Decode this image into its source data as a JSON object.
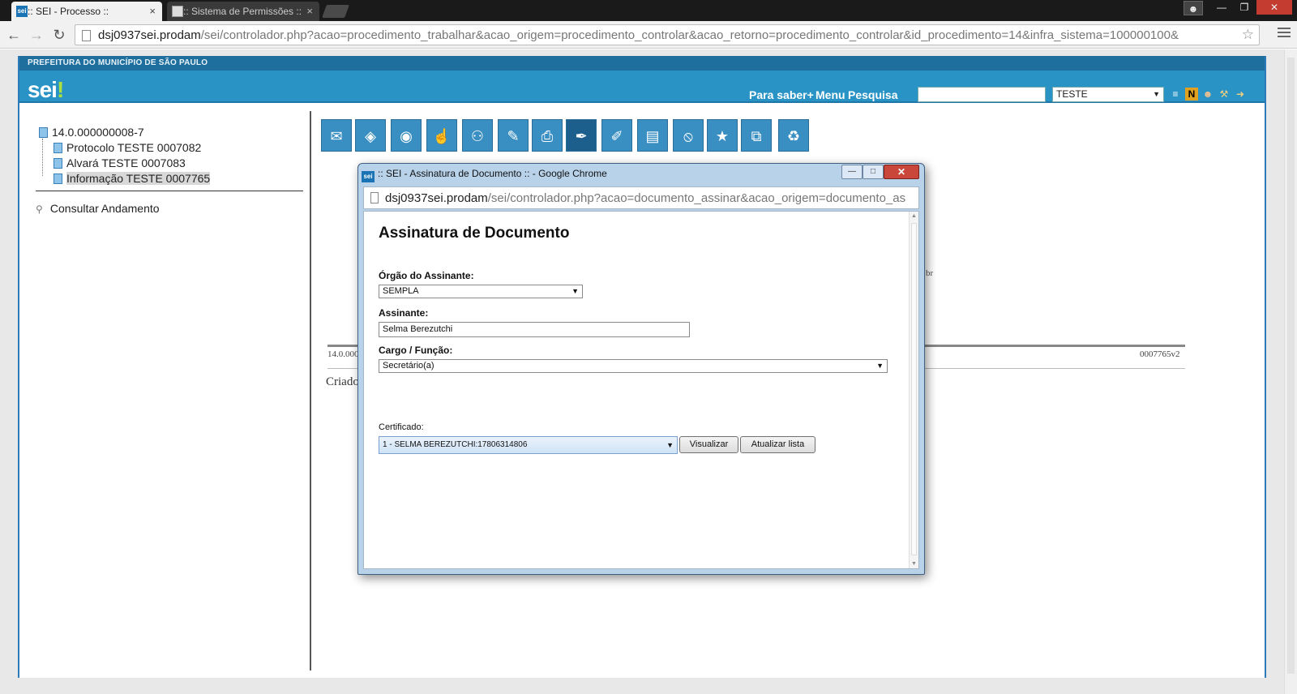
{
  "browser": {
    "tabs": [
      {
        "label": ":: SEI - Processo ::",
        "favicon": "sei"
      },
      {
        "label": ":: Sistema de Permissões ::",
        "favicon": "page"
      }
    ],
    "url_host": "dsj0937sei.prodam",
    "url_path": "/sei/controlador.php?acao=procedimento_trabalhar&acao_origem=procedimento_controlar&acao_retorno=procedimento_controlar&id_procedimento=14&infra_sistema=100000100&"
  },
  "header": {
    "org": "PREFEITURA DO MUNICÍPIO DE SÃO PAULO",
    "logo": "sei",
    "logo_mark": "!",
    "links": [
      "Para saber+",
      "Menu",
      "Pesquisa"
    ],
    "unit_select": "TESTE"
  },
  "tree": {
    "root": "14.0.000000008-7",
    "children": [
      "Protocolo TESTE 0007082",
      "Alvará TESTE 0007083",
      "Informação TESTE 0007765"
    ],
    "consult": "Consultar Andamento"
  },
  "document": {
    "left_code": "14.0.000",
    "right_code": "0007765v2",
    "criado": "Criado",
    "fragment": "br"
  },
  "popup": {
    "title": ":: SEI - Assinatura de Documento :: - Google Chrome",
    "url_host": "dsj0937sei.prodam",
    "url_path": "/sei/controlador.php?acao=documento_assinar&acao_origem=documento_as",
    "form_title": "Assinatura de Documento",
    "orgao_label": "Órgão do Assinante:",
    "orgao_value": "SEMPLA",
    "assinante_label": "Assinante:",
    "assinante_value": "Selma Berezutchi",
    "cargo_label": "Cargo / Função:",
    "cargo_value": "Secretário(a)",
    "certificado_label": "Certificado:",
    "certificado_value": "1 - SELMA BEREZUTCHI:17806314806",
    "visualizar": "Visualizar",
    "atualizar": "Atualizar lista"
  },
  "colors": {
    "header": "#2a93c5",
    "accent": "#1f6f9e"
  }
}
